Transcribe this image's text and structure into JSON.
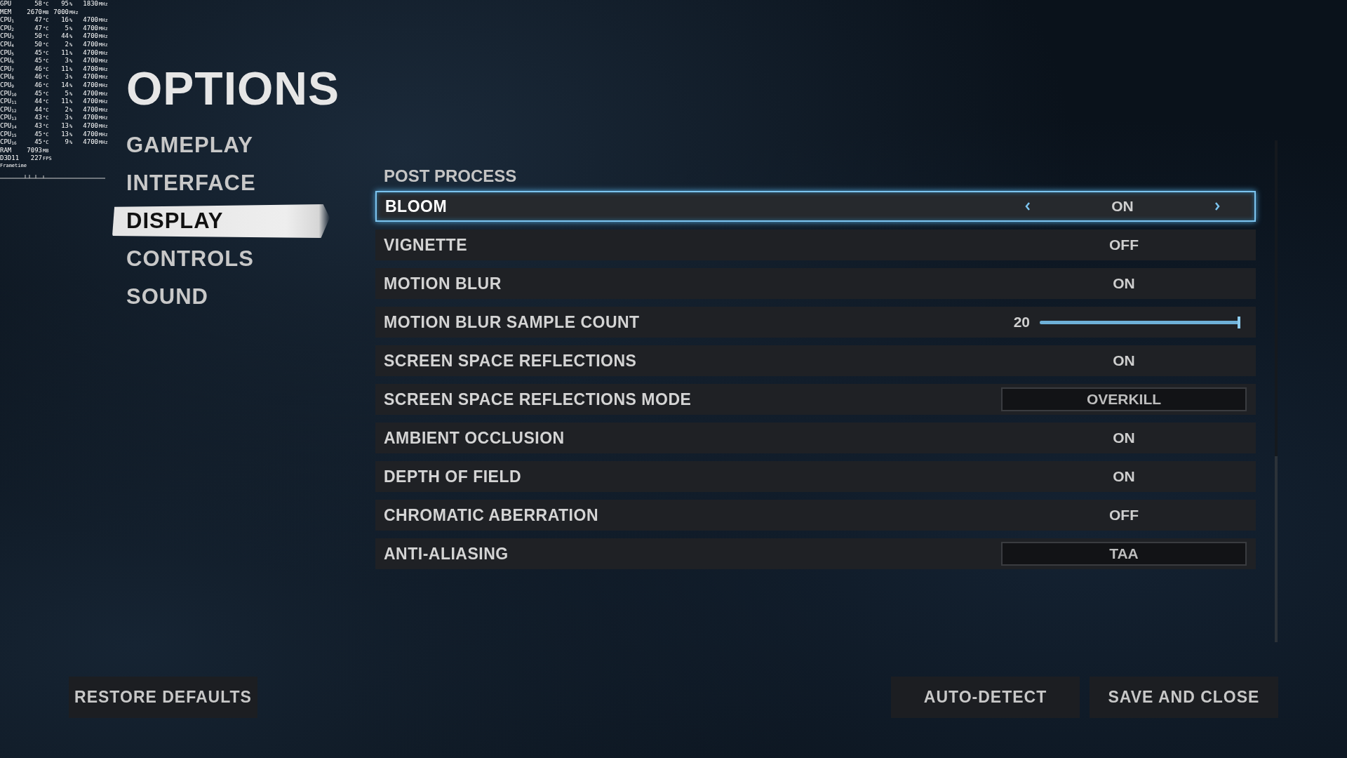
{
  "overlay": {
    "rows": [
      {
        "label": "GPU",
        "cells": [
          {
            "value": "58",
            "unit": "°C"
          },
          {
            "value": "95",
            "unit": "%"
          },
          {
            "value": "1830",
            "unit": "MHz"
          }
        ]
      },
      {
        "label": "MEM",
        "cells": [
          {
            "value": "2670",
            "unit": "MB"
          },
          {
            "value": "7000",
            "unit": "MHz"
          }
        ]
      },
      {
        "label": "CPU$_{1}$",
        "cells": [
          {
            "value": "47",
            "unit": "°C"
          },
          {
            "value": "16",
            "unit": "%"
          },
          {
            "value": "4700",
            "unit": "MHz"
          }
        ]
      },
      {
        "label": "CPU$_{2}$",
        "cells": [
          {
            "value": "47",
            "unit": "°C"
          },
          {
            "value": "5",
            "unit": "%"
          },
          {
            "value": "4700",
            "unit": "MHz"
          }
        ]
      },
      {
        "label": "CPU$_{3}$",
        "cells": [
          {
            "value": "50",
            "unit": "°C"
          },
          {
            "value": "44",
            "unit": "%"
          },
          {
            "value": "4700",
            "unit": "MHz"
          }
        ]
      },
      {
        "label": "CPU$_{4}$",
        "cells": [
          {
            "value": "50",
            "unit": "°C"
          },
          {
            "value": "2",
            "unit": "%"
          },
          {
            "value": "4700",
            "unit": "MHz"
          }
        ]
      },
      {
        "label": "CPU$_{5}$",
        "cells": [
          {
            "value": "45",
            "unit": "°C"
          },
          {
            "value": "11",
            "unit": "%"
          },
          {
            "value": "4700",
            "unit": "MHz"
          }
        ]
      },
      {
        "label": "CPU$_{6}$",
        "cells": [
          {
            "value": "45",
            "unit": "°C"
          },
          {
            "value": "3",
            "unit": "%"
          },
          {
            "value": "4700",
            "unit": "MHz"
          }
        ]
      },
      {
        "label": "CPU$_{7}$",
        "cells": [
          {
            "value": "46",
            "unit": "°C"
          },
          {
            "value": "11",
            "unit": "%"
          },
          {
            "value": "4700",
            "unit": "MHz"
          }
        ]
      },
      {
        "label": "CPU$_{8}$",
        "cells": [
          {
            "value": "46",
            "unit": "°C"
          },
          {
            "value": "3",
            "unit": "%"
          },
          {
            "value": "4700",
            "unit": "MHz"
          }
        ]
      },
      {
        "label": "CPU$_{9}$",
        "cells": [
          {
            "value": "46",
            "unit": "°C"
          },
          {
            "value": "14",
            "unit": "%"
          },
          {
            "value": "4700",
            "unit": "MHz"
          }
        ]
      },
      {
        "label": "CPU$_{10}$",
        "cells": [
          {
            "value": "45",
            "unit": "°C"
          },
          {
            "value": "5",
            "unit": "%"
          },
          {
            "value": "4700",
            "unit": "MHz"
          }
        ]
      },
      {
        "label": "CPU$_{11}$",
        "cells": [
          {
            "value": "44",
            "unit": "°C"
          },
          {
            "value": "11",
            "unit": "%"
          },
          {
            "value": "4700",
            "unit": "MHz"
          }
        ]
      },
      {
        "label": "CPU$_{12}$",
        "cells": [
          {
            "value": "44",
            "unit": "°C"
          },
          {
            "value": "2",
            "unit": "%"
          },
          {
            "value": "4700",
            "unit": "MHz"
          }
        ]
      },
      {
        "label": "CPU$_{13}$",
        "cells": [
          {
            "value": "43",
            "unit": "°C"
          },
          {
            "value": "3",
            "unit": "%"
          },
          {
            "value": "4700",
            "unit": "MHz"
          }
        ]
      },
      {
        "label": "CPU$_{14}$",
        "cells": [
          {
            "value": "43",
            "unit": "°C"
          },
          {
            "value": "13",
            "unit": "%"
          },
          {
            "value": "4700",
            "unit": "MHz"
          }
        ]
      },
      {
        "label": "CPU$_{15}$",
        "cells": [
          {
            "value": "45",
            "unit": "°C"
          },
          {
            "value": "13",
            "unit": "%"
          },
          {
            "value": "4700",
            "unit": "MHz"
          }
        ]
      },
      {
        "label": "CPU$_{16}$",
        "cells": [
          {
            "value": "45",
            "unit": "°C"
          },
          {
            "value": "9",
            "unit": "%"
          },
          {
            "value": "4700",
            "unit": "MHz"
          }
        ]
      },
      {
        "label": "RAM",
        "cells": [
          {
            "value": "7093",
            "unit": "MB"
          }
        ]
      },
      {
        "label": "D3D11",
        "cells": [
          {
            "value": "227",
            "unit": "FPS"
          }
        ]
      }
    ],
    "frametime_label": "Frametime"
  },
  "title": "OPTIONS",
  "nav": [
    {
      "label": "GAMEPLAY",
      "selected": false
    },
    {
      "label": "INTERFACE",
      "selected": false
    },
    {
      "label": "DISPLAY",
      "selected": true
    },
    {
      "label": "CONTROLS",
      "selected": false
    },
    {
      "label": "SOUND",
      "selected": false
    }
  ],
  "section": "POST PROCESS",
  "settings": [
    {
      "kind": "toggle",
      "label": "BLOOM",
      "value": "ON",
      "focused": true
    },
    {
      "kind": "toggle",
      "label": "VIGNETTE",
      "value": "OFF",
      "focused": false
    },
    {
      "kind": "toggle",
      "label": "MOTION BLUR",
      "value": "ON",
      "focused": false
    },
    {
      "kind": "slider",
      "label": "MOTION BLUR SAMPLE COUNT",
      "value": "20",
      "level": 1.0,
      "focused": false
    },
    {
      "kind": "toggle",
      "label": "SCREEN SPACE REFLECTIONS",
      "value": "ON",
      "focused": false
    },
    {
      "kind": "dropdown",
      "label": "SCREEN SPACE REFLECTIONS MODE",
      "value": "OVERKILL",
      "focused": false
    },
    {
      "kind": "toggle",
      "label": "AMBIENT OCCLUSION",
      "value": "ON",
      "focused": false
    },
    {
      "kind": "toggle",
      "label": "DEPTH OF FIELD",
      "value": "ON",
      "focused": false
    },
    {
      "kind": "toggle",
      "label": "CHROMATIC ABERRATION",
      "value": "OFF",
      "focused": false
    },
    {
      "kind": "dropdown",
      "label": "ANTI-ALIASING",
      "value": "TAA",
      "focused": false
    }
  ],
  "buttons": {
    "left": [
      "RESTORE DEFAULTS"
    ],
    "right": [
      "AUTO-DETECT",
      "SAVE AND CLOSE"
    ]
  }
}
